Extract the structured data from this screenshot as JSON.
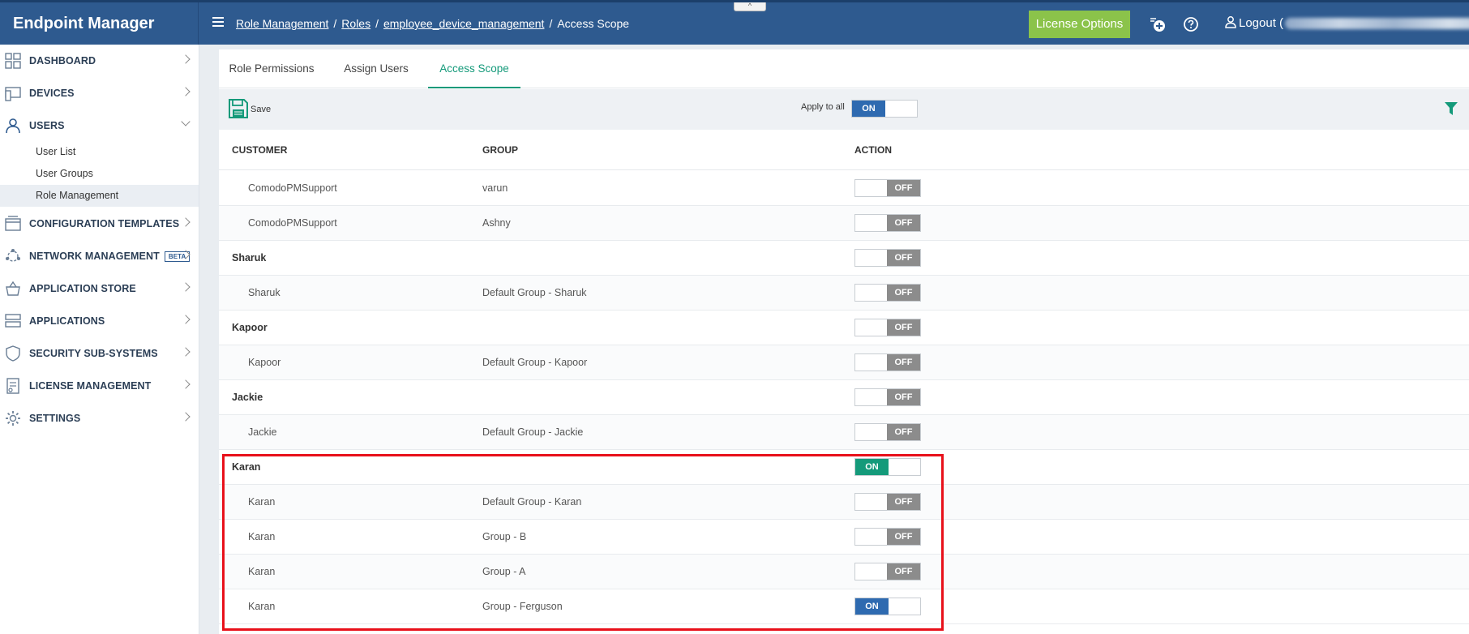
{
  "header": {
    "brand": "Endpoint Manager",
    "breadcrumb": [
      "Role Management",
      "Roles",
      "employee_device_management",
      "Access Scope"
    ],
    "license_button": "License Options",
    "logout_label": "Logout (",
    "logout_suffix": ")",
    "collapse_glyph": "^"
  },
  "sidebar": {
    "items": [
      {
        "label": "DASHBOARD",
        "icon": "dashboard-icon"
      },
      {
        "label": "DEVICES",
        "icon": "devices-icon"
      },
      {
        "label": "USERS",
        "icon": "user-icon"
      },
      {
        "label": "CONFIGURATION TEMPLATES",
        "icon": "templates-icon"
      },
      {
        "label": "NETWORK MANAGEMENT",
        "icon": "network-icon",
        "badge": "BETA"
      },
      {
        "label": "APPLICATION STORE",
        "icon": "store-icon"
      },
      {
        "label": "APPLICATIONS",
        "icon": "applications-icon"
      },
      {
        "label": "SECURITY SUB-SYSTEMS",
        "icon": "shield-icon"
      },
      {
        "label": "LICENSE MANAGEMENT",
        "icon": "license-icon"
      },
      {
        "label": "SETTINGS",
        "icon": "gear-icon"
      }
    ],
    "users_sub": [
      "User List",
      "User Groups",
      "Role Management"
    ],
    "active_sub": "Role Management"
  },
  "tabs": [
    "Role Permissions",
    "Assign Users",
    "Access Scope"
  ],
  "active_tab": "Access Scope",
  "toolbar": {
    "save_label": "Save",
    "apply_label": "Apply to all",
    "apply_state": "ON"
  },
  "table": {
    "headers": [
      "CUSTOMER",
      "GROUP",
      "ACTION"
    ],
    "rows": [
      {
        "customer": "ComodoPMSupport",
        "group": "varun",
        "state": "OFF",
        "type": "child"
      },
      {
        "customer": "ComodoPMSupport",
        "group": "Ashny",
        "state": "OFF",
        "type": "child"
      },
      {
        "customer": "Sharuk",
        "group": "",
        "state": "OFF",
        "type": "parent"
      },
      {
        "customer": "Sharuk",
        "group": "Default Group - Sharuk",
        "state": "OFF",
        "type": "child"
      },
      {
        "customer": "Kapoor",
        "group": "",
        "state": "OFF",
        "type": "parent"
      },
      {
        "customer": "Kapoor",
        "group": "Default Group - Kapoor",
        "state": "OFF",
        "type": "child"
      },
      {
        "customer": "Jackie",
        "group": "",
        "state": "OFF",
        "type": "parent"
      },
      {
        "customer": "Jackie",
        "group": "Default Group - Jackie",
        "state": "OFF",
        "type": "child"
      },
      {
        "customer": "Karan",
        "group": "",
        "state": "ON",
        "type": "parent",
        "color": "green"
      },
      {
        "customer": "Karan",
        "group": "Default Group - Karan",
        "state": "OFF",
        "type": "child"
      },
      {
        "customer": "Karan",
        "group": "Group - B",
        "state": "OFF",
        "type": "child"
      },
      {
        "customer": "Karan",
        "group": "Group - A",
        "state": "OFF",
        "type": "child"
      },
      {
        "customer": "Karan",
        "group": "Group - Ferguson",
        "state": "ON",
        "type": "child",
        "color": "blue"
      }
    ]
  },
  "colors": {
    "header_bg": "#2e5a8f",
    "accent_green": "#149a7a",
    "toggle_blue": "#2e6ab0",
    "license_green": "#8bc34a",
    "highlight_red": "#e8101a"
  }
}
